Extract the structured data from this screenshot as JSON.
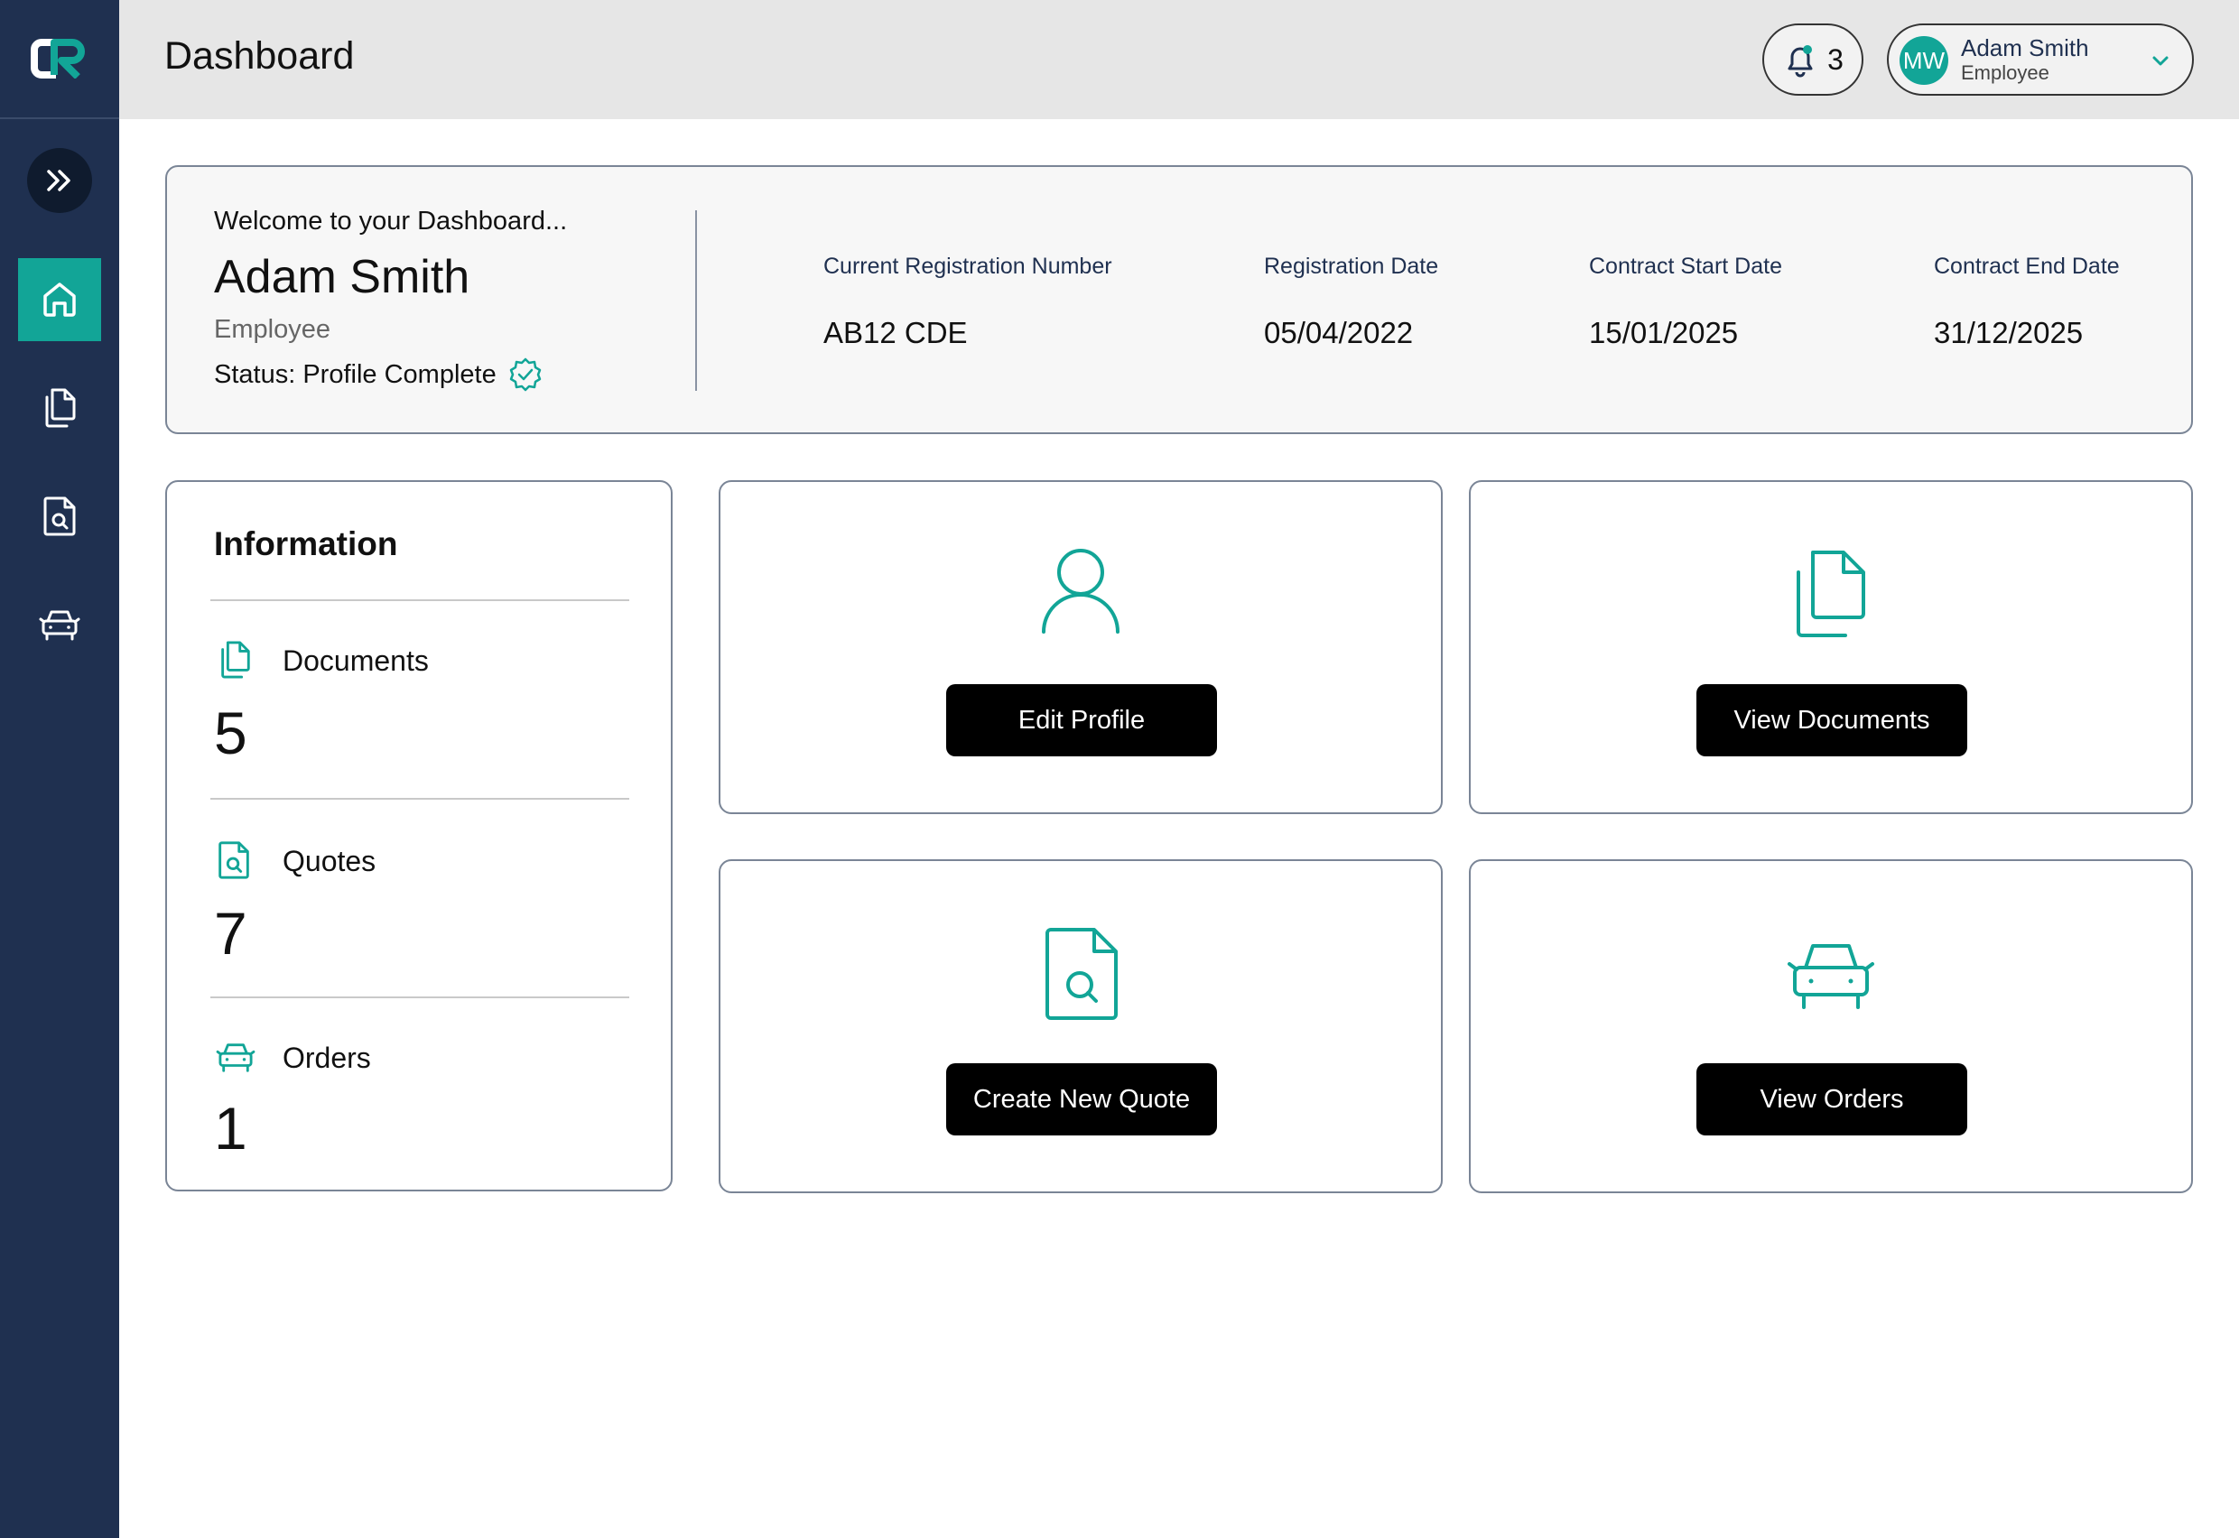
{
  "app": {
    "brand_color": "#12a597",
    "sidebar_color": "#1f3050"
  },
  "header": {
    "title": "Dashboard",
    "notifications_count": "3",
    "user": {
      "initials": "MW",
      "name": "Adam Smith",
      "role": "Employee"
    }
  },
  "sidebar": {
    "items": [
      {
        "name": "home",
        "icon": "home-icon",
        "active": true
      },
      {
        "name": "documents",
        "icon": "documents-icon",
        "active": false
      },
      {
        "name": "quotes",
        "icon": "file-search-icon",
        "active": false
      },
      {
        "name": "orders",
        "icon": "car-icon",
        "active": false
      }
    ]
  },
  "welcome": {
    "greeting": "Welcome to your Dashboard...",
    "name": "Adam Smith",
    "role": "Employee",
    "status": "Status: Profile Complete",
    "fields": [
      {
        "label": "Current Registration Number",
        "value": "AB12 CDE"
      },
      {
        "label": "Registration Date",
        "value": "05/04/2022"
      },
      {
        "label": "Contract Start Date",
        "value": "15/01/2025"
      },
      {
        "label": "Contract End Date",
        "value": "31/12/2025"
      }
    ]
  },
  "info": {
    "title": "Information",
    "rows": [
      {
        "label": "Documents",
        "count": "5",
        "icon": "documents-icon"
      },
      {
        "label": "Quotes",
        "count": "7",
        "icon": "file-search-icon"
      },
      {
        "label": "Orders",
        "count": "1",
        "icon": "car-icon"
      }
    ]
  },
  "actions": [
    {
      "label": "Edit Profile",
      "icon": "user-icon"
    },
    {
      "label": "View Documents",
      "icon": "documents-icon"
    },
    {
      "label": "Create New Quote",
      "icon": "file-search-icon"
    },
    {
      "label": "View Orders",
      "icon": "car-icon"
    }
  ]
}
